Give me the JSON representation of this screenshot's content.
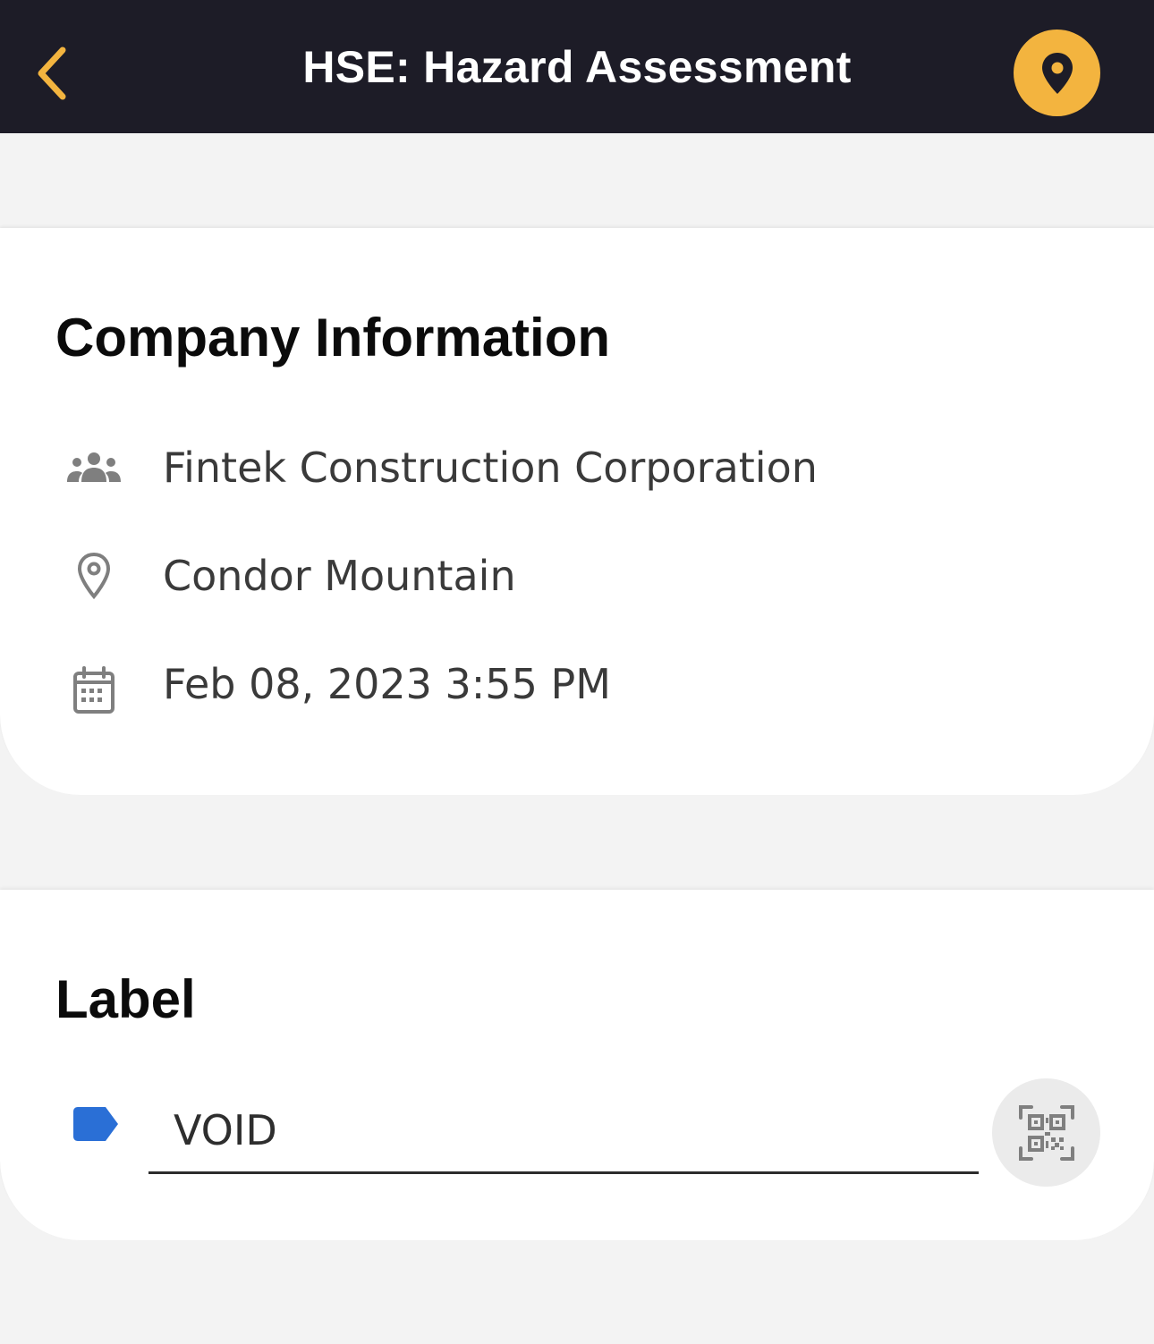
{
  "header": {
    "title": "HSE: Hazard Assessment",
    "back_icon": "chevron-left-icon",
    "location_icon": "map-pin-icon"
  },
  "company_info": {
    "title": "Company Information",
    "company": "Fintek Construction Corporation",
    "location": "Condor Mountain",
    "datetime": "Feb 08, 2023 3:55 PM",
    "icons": [
      "group-icon",
      "location-pin-icon",
      "calendar-icon"
    ]
  },
  "label_section": {
    "title": "Label",
    "value": "VOID",
    "tag_icon": "tag-icon",
    "scan_icon": "qr-code-icon"
  },
  "colors": {
    "header_bg": "#1d1c27",
    "accent": "#f3b43f",
    "tag_blue": "#2a6fd6",
    "page_bg": "#f3f3f3"
  }
}
